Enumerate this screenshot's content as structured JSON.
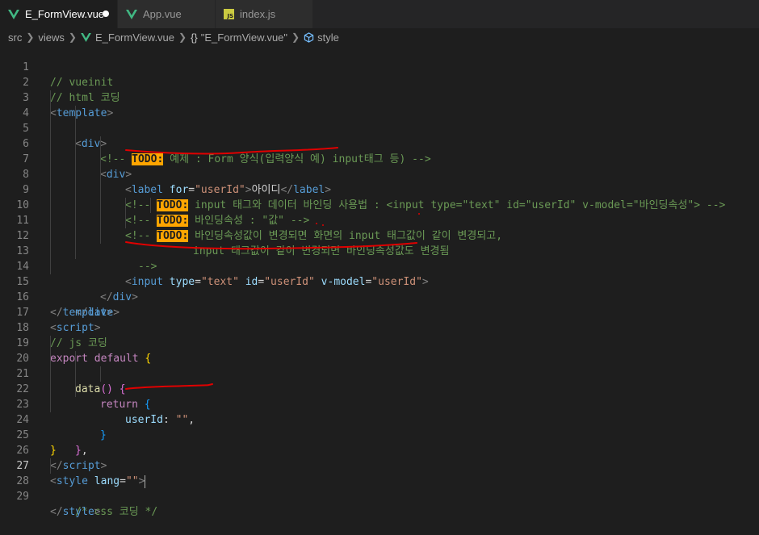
{
  "tabs": [
    {
      "label": "E_FormView.vue",
      "icon": "vue-icon",
      "active": true,
      "modified": true
    },
    {
      "label": "App.vue",
      "icon": "vue-icon",
      "active": false
    },
    {
      "label": "index.js",
      "icon": "js-icon",
      "active": false,
      "badge": "JS"
    }
  ],
  "breadcrumb": {
    "items": [
      "src",
      "views",
      "E_FormView.vue",
      "{}",
      "\"E_FormView.vue\"",
      "style"
    ]
  },
  "editor": {
    "current_line": 27,
    "lines": [
      {
        "n": "1"
      },
      {
        "n": "2"
      },
      {
        "n": "3"
      },
      {
        "n": "4"
      },
      {
        "n": "5"
      },
      {
        "n": "6"
      },
      {
        "n": "7"
      },
      {
        "n": "8"
      },
      {
        "n": "9"
      },
      {
        "n": "10"
      },
      {
        "n": "11"
      },
      {
        "n": "12"
      },
      {
        "n": "13"
      },
      {
        "n": "14"
      },
      {
        "n": "15"
      },
      {
        "n": "16"
      },
      {
        "n": "17"
      },
      {
        "n": "18"
      },
      {
        "n": "19"
      },
      {
        "n": "20"
      },
      {
        "n": "21"
      },
      {
        "n": "22"
      },
      {
        "n": "23"
      },
      {
        "n": "24"
      },
      {
        "n": "25"
      },
      {
        "n": "26"
      },
      {
        "n": "27"
      },
      {
        "n": "28"
      },
      {
        "n": "29"
      }
    ],
    "tokens": {
      "l1": "// vueinit",
      "l2": "// html 코딩",
      "l3_tag": "template",
      "l4_tag": "div",
      "l5_open": "<!-- ",
      "l5_todo": "TODO:",
      "l5_rest": " 예제 : Form 양식(입력양식 예) input태그 등) -->",
      "l6_tag": "div",
      "l7_tag": "label",
      "l7_attr": "for",
      "l7_val": "\"userId\"",
      "l7_text": "아이디",
      "l8_open": "<!-- ",
      "l8_todo": "TODO:",
      "l8_rest": " input 태그와 데이터 바인딩 사용법 : <input type=\"text\" id=\"userId\" v-model=\"바인딩속성\"> -->",
      "l9_open": "<!-- ",
      "l9_todo": "TODO:",
      "l9_rest": " 바인딩속성 : \"값\" -->",
      "l10_open": "<!-- ",
      "l10_todo": "TODO:",
      "l10_rest": " 바인딩속성값이 변경되면 화면의 input 태그값이 같이 변경되고,",
      "l11": "input 태그값이 같이 변경되면 바인딩속성값도 변경됨",
      "l12": "-->",
      "l13_tag": "input",
      "l13_a1": "type",
      "l13_v1": "\"text\"",
      "l13_a2": "id",
      "l13_v2": "\"userId\"",
      "l13_a3": "v-model",
      "l13_v3": "\"userId\"",
      "l14_tag": "div",
      "l15_tag": "div",
      "l16_tag": "template",
      "l17_tag": "script",
      "l18": "// js 코딩",
      "l19_kw": "export default",
      "l20_fn": "data",
      "l21_kw": "return",
      "l22_key": "userId",
      "l22_val": "\"\"",
      "l26_tag": "script",
      "l27_tag": "style",
      "l27_attr": "lang",
      "l27_val": "\"\"",
      "l28": "/* css 코딩 */",
      "l29_tag": "style"
    }
  },
  "colors": {
    "background": "#1e1e1e",
    "tag": "#569cd6",
    "attribute": "#9cdcfe",
    "string": "#ce9178",
    "comment": "#6a9955",
    "keyword": "#c586c0",
    "todo_highlight": "#ffa500",
    "annotation_ink": "#e00000"
  }
}
